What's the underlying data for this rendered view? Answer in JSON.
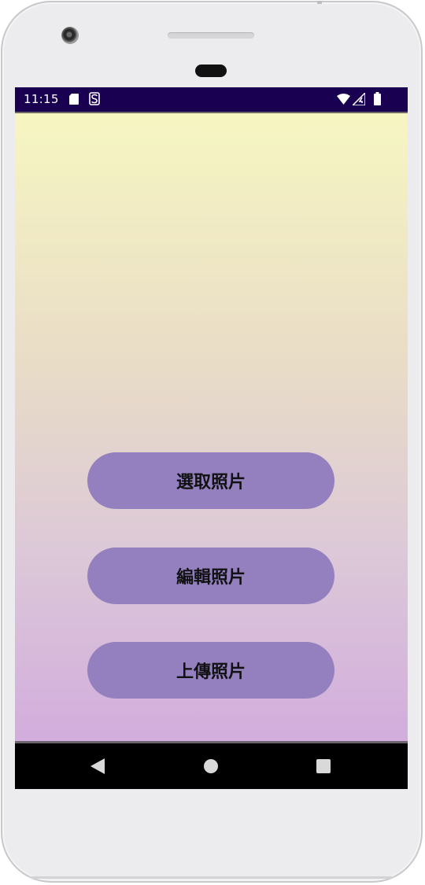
{
  "status_bar": {
    "time": "11:15",
    "left_icons": [
      "sim-card-icon",
      "storage-s-icon"
    ],
    "right_icons": [
      "wifi-icon",
      "signal-icon",
      "battery-icon"
    ],
    "background": "#1a0050"
  },
  "app": {
    "background_gradient": [
      "#f6f6c1",
      "#d2addd"
    ],
    "button_color": "#9480bf",
    "buttons": [
      {
        "label": "選取照片"
      },
      {
        "label": "編輯照片"
      },
      {
        "label": "上傳照片"
      }
    ]
  },
  "nav_bar": {
    "icons": [
      "back-icon",
      "home-icon",
      "recents-icon"
    ]
  }
}
